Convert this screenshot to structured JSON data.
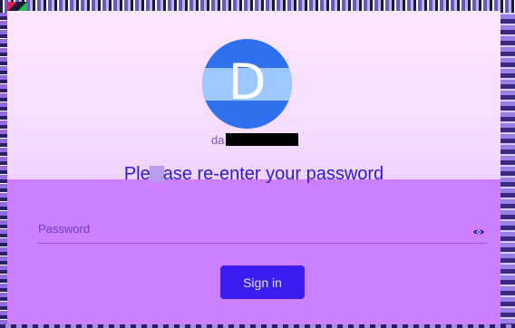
{
  "dialog": {
    "avatar_letter": "D",
    "username_visible": "da",
    "heading_part1": "Ple",
    "heading_part2": "ase re-enter your password",
    "password_placeholder": "Password",
    "password_value": "",
    "signin_label": "Sign in"
  },
  "icons": {
    "password_toggle": "eye-icon"
  },
  "colors": {
    "accent": "#3a1ef0",
    "heading": "#2a1ad8",
    "avatar": "#2f6ff0",
    "card": "#cc80ff"
  }
}
